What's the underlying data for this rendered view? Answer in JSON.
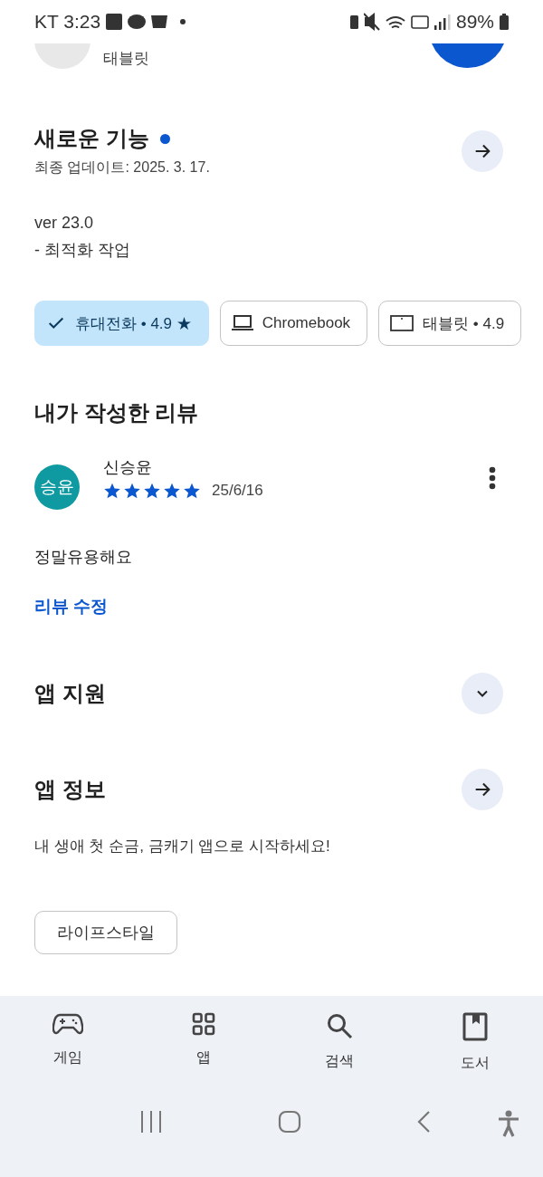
{
  "status_bar": {
    "carrier_time": "KT 3:23",
    "battery": "89%"
  },
  "app_header": {
    "subtitle": "태블릿"
  },
  "whats_new": {
    "title": "새로운 기능",
    "new_dot": true,
    "updated": "최종 업데이트: 2025. 3. 17.",
    "lines": [
      "ver 23.0",
      "- 최적화 작업"
    ]
  },
  "device_chips": [
    {
      "kind": "phone",
      "label": "휴대전화 • 4.9 ★",
      "selected": true
    },
    {
      "kind": "laptop",
      "label": "Chromebook",
      "selected": false
    },
    {
      "kind": "tablet",
      "label": "태블릿 • 4.9",
      "selected": false
    }
  ],
  "my_review": {
    "title": "내가 작성한 리뷰",
    "avatar": "승윤",
    "name": "신승윤",
    "stars": 5,
    "date": "25/6/16",
    "text": "정말유용해요",
    "edit_link": "리뷰 수정"
  },
  "app_support": {
    "title": "앱 지원",
    "expanded": false
  },
  "app_info": {
    "title": "앱 정보",
    "description": "내 생애 첫 순금, 금캐기 앱으로 시작하세요!",
    "category": "라이프스타일"
  },
  "bottom_nav": [
    {
      "kind": "games",
      "label": "게임",
      "selected": false
    },
    {
      "kind": "apps",
      "label": "앱",
      "selected": false
    },
    {
      "kind": "search",
      "label": "검색",
      "selected": false
    },
    {
      "kind": "books",
      "label": "도서",
      "selected": false
    }
  ]
}
